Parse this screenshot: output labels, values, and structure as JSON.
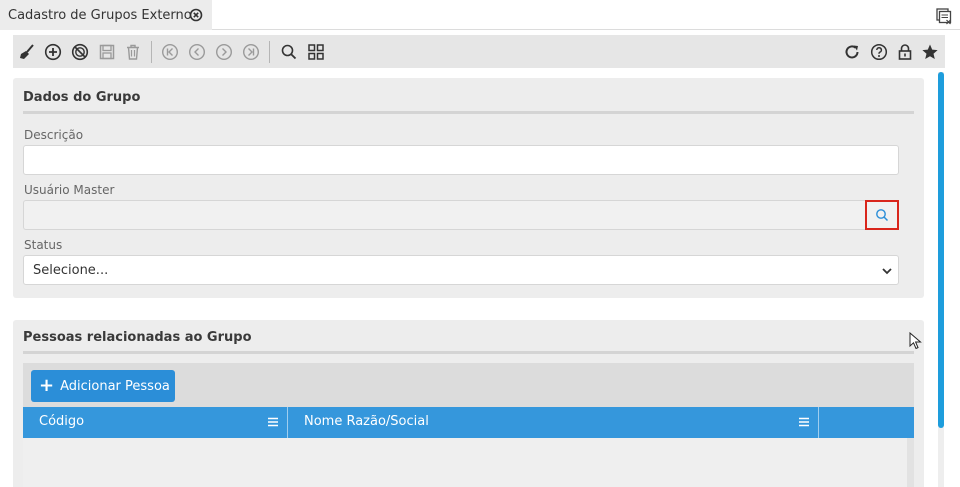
{
  "tab": {
    "title": "Cadastro de Grupos Externo",
    "close_icon": "close-circle-icon"
  },
  "tabbar": {
    "right_icon": "window-list-icon"
  },
  "toolbar": {
    "left_icons": [
      "broom-icon",
      "add-circle-icon",
      "cancel-circle-icon",
      "save-icon",
      "trash-icon",
      "first-record-icon",
      "previous-record-icon",
      "next-record-icon",
      "last-record-icon",
      "search-icon",
      "grid-icon"
    ],
    "right_icons": [
      "refresh-icon",
      "help-icon",
      "lock-icon",
      "star-icon"
    ]
  },
  "group_panel": {
    "title": "Dados do Grupo",
    "descricao_label": "Descrição",
    "descricao_value": "",
    "usuario_label": "Usuário Master",
    "usuario_value": "",
    "status_label": "Status",
    "status_selected": "Selecione..."
  },
  "people_panel": {
    "title": "Pessoas relacionadas ao Grupo",
    "add_button_label": "Adicionar Pessoa",
    "columns": [
      "Código",
      "Nome Razão/Social"
    ]
  },
  "colors": {
    "accent": "#2b8ed8",
    "grid_header": "#3597dc",
    "highlight_border": "#d9261c",
    "scrollbar": "#1e9ddc"
  }
}
